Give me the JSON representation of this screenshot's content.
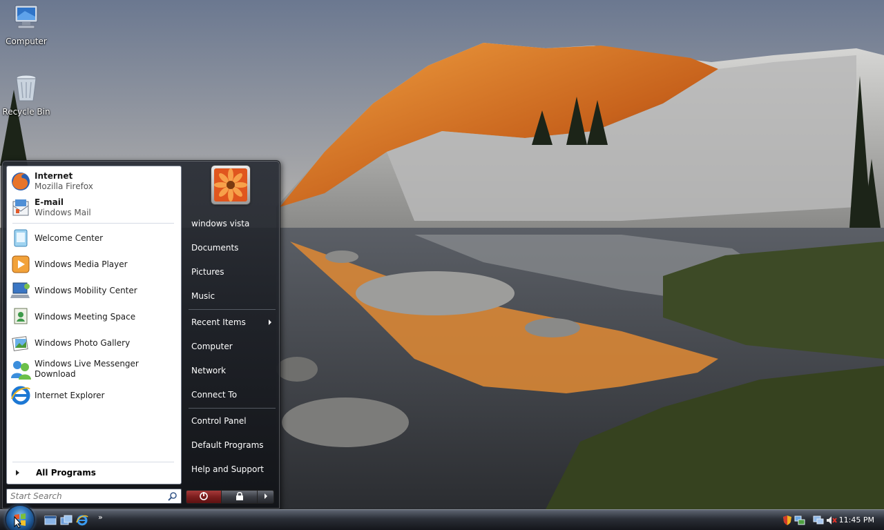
{
  "desktop": {
    "icons": [
      {
        "label": "Computer",
        "icon": "computer-icon"
      },
      {
        "label": "Recycle Bin",
        "icon": "recycle-bin-icon"
      }
    ]
  },
  "start_menu": {
    "pinned": [
      {
        "title": "Internet",
        "subtitle": "Mozilla Firefox",
        "icon": "firefox-icon"
      },
      {
        "title": "E-mail",
        "subtitle": "Windows Mail",
        "icon": "windows-mail-icon"
      }
    ],
    "recent": [
      {
        "label": "Welcome Center",
        "icon": "welcome-center-icon"
      },
      {
        "label": "Windows Media Player",
        "icon": "media-player-icon"
      },
      {
        "label": "Windows Mobility Center",
        "icon": "mobility-center-icon"
      },
      {
        "label": "Windows Meeting Space",
        "icon": "meeting-space-icon"
      },
      {
        "label": "Windows Photo Gallery",
        "icon": "photo-gallery-icon"
      },
      {
        "label": "Windows Live Messenger Download",
        "icon": "messenger-icon"
      },
      {
        "label": "Internet Explorer",
        "icon": "internet-explorer-icon"
      }
    ],
    "all_programs": "All Programs",
    "search_placeholder": "Start Search",
    "right": {
      "user_name": "windows vista",
      "items": [
        "Documents",
        "Pictures",
        "Music",
        "Recent Items",
        "Computer",
        "Network",
        "Connect To",
        "Control Panel",
        "Default Programs",
        "Help and Support"
      ]
    }
  },
  "taskbar": {
    "clock": "11:45 PM",
    "quick_launch": [
      "show-desktop-icon",
      "switch-windows-icon",
      "internet-explorer-icon"
    ],
    "tray": [
      "security-shield-icon",
      "network-icon",
      "display-icon",
      "volume-muted-icon"
    ]
  },
  "colors": {
    "taskbar": "#1b1e24",
    "menu_dark": "#1f2228",
    "accent_orange": "#e8892c"
  }
}
